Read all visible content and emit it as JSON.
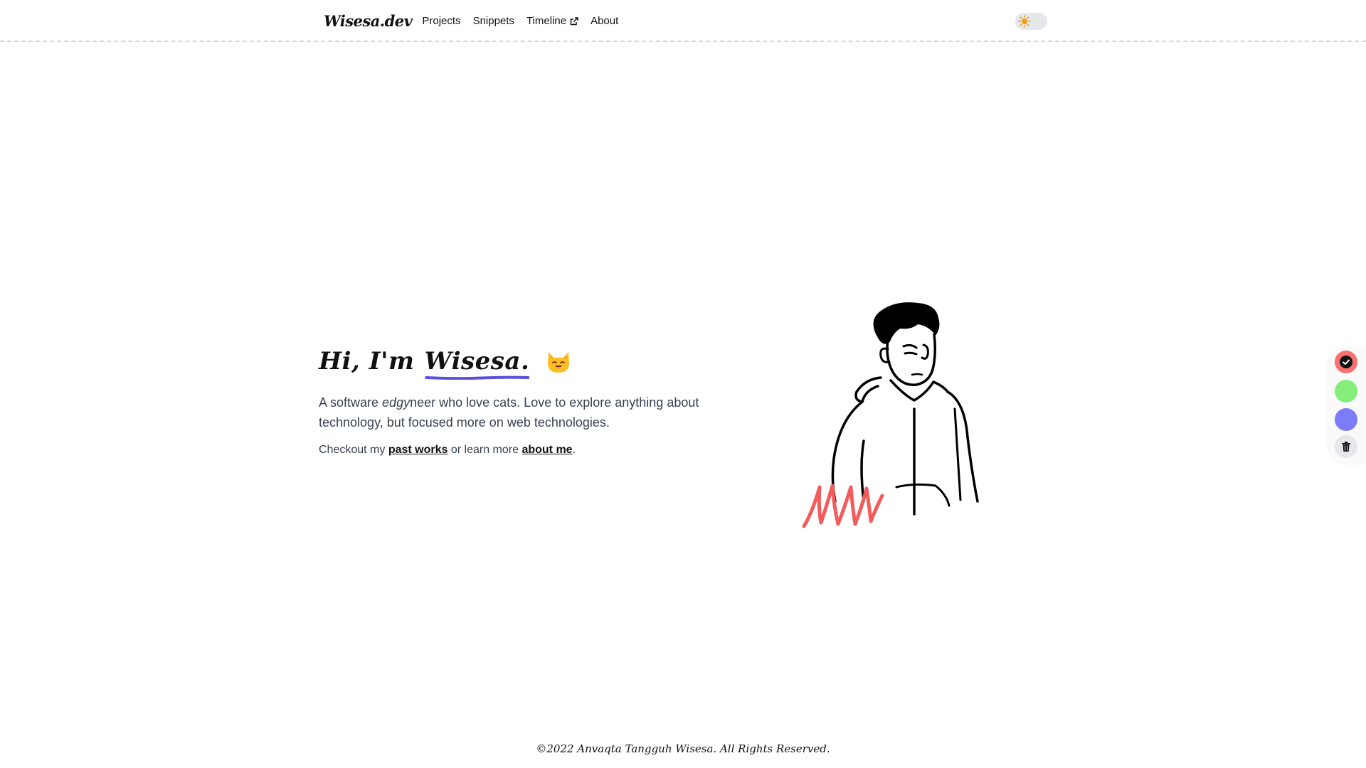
{
  "header": {
    "brand": "Wisesa.dev",
    "nav": [
      {
        "label": "Projects"
      },
      {
        "label": "Snippets"
      },
      {
        "label": "Timeline",
        "external": true
      },
      {
        "label": "About"
      }
    ],
    "theme_toggle_icon": "sun-icon"
  },
  "hero": {
    "greeting": "Hi, I'm",
    "name": "Wisesa.",
    "emoji_icon": "cat-face-icon",
    "desc_part1": "A software ",
    "desc_em": "edgy",
    "desc_part2": "neer who love cats. Love to explore anything about technology, but focused more on web technologies.",
    "cta_prefix": "Checkout my ",
    "cta_link1": "past works",
    "cta_middle": " or learn more ",
    "cta_link2": "about me",
    "cta_suffix": "."
  },
  "palette": {
    "colors": [
      "#f87171",
      "#86ef7c",
      "#7c7cf8"
    ],
    "selected": 0,
    "clear_icon": "trash-icon"
  },
  "footer": {
    "text": "©2022 Anvaqta Tangguh Wisesa. All Rights Reserved."
  },
  "theme": {
    "underline_color": "#5b4fe0",
    "scribble_color": "#f25c5c"
  }
}
